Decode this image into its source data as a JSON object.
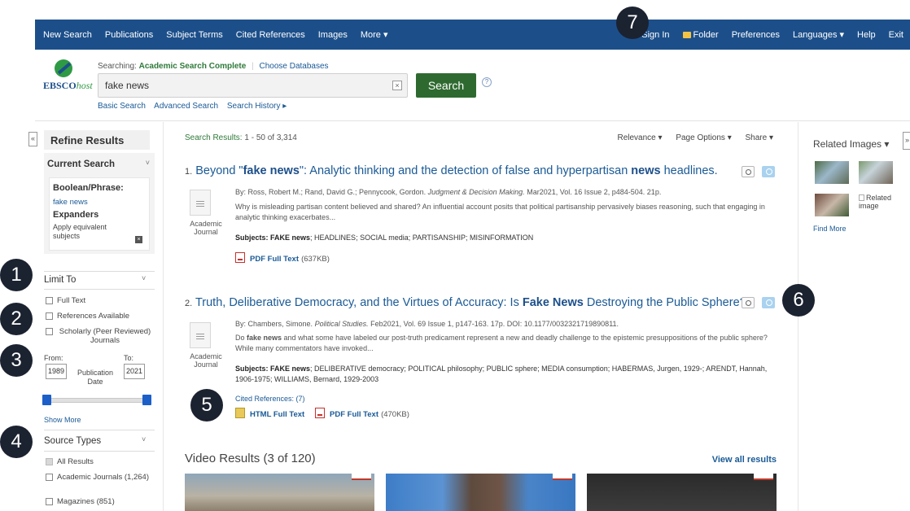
{
  "topnav": {
    "left": [
      "New Search",
      "Publications",
      "Subject Terms",
      "Cited References",
      "Images",
      "More ▾"
    ],
    "right": {
      "sign_in": "Sign In",
      "folder": "Folder",
      "preferences": "Preferences",
      "languages": "Languages ▾",
      "help": "Help",
      "exit": "Exit"
    }
  },
  "header": {
    "logo_main": "EBSCO",
    "logo_sub": "host",
    "searching_label": "Searching:",
    "database": "Academic Search Complete",
    "choose_db": "Choose Databases",
    "query": "fake news",
    "search_button": "Search",
    "links": [
      "Basic Search",
      "Advanced Search",
      "Search History ▸"
    ]
  },
  "sidebar": {
    "refine_title": "Refine Results",
    "current_search": {
      "title": "Current Search",
      "boolean_label": "Boolean/Phrase:",
      "term": "fake news",
      "expanders_label": "Expanders",
      "expander_item": "Apply equivalent subjects"
    },
    "limit_to": {
      "title": "Limit To",
      "options": [
        "Full Text",
        "References Available",
        "Scholarly (Peer Reviewed) Journals"
      ],
      "from_label": "From:",
      "to_label": "To:",
      "from_year": "1989",
      "to_year": "2021",
      "date_label": "Publication Date",
      "show_more": "Show More"
    },
    "source_types": {
      "title": "Source Types",
      "options": [
        "All Results",
        "Academic Journals (1,264)",
        "Magazines (851)"
      ]
    }
  },
  "main": {
    "results_label": "Search Results:",
    "results_range": "1 - 50 of 3,314",
    "options": [
      "Relevance ▾",
      "Page Options ▾",
      "Share ▾"
    ],
    "results": [
      {
        "num": "1.",
        "title_pre": "Beyond \"",
        "title_bold1": "fake news",
        "title_mid": "\": Analytic thinking and the detection of false and hyperpartisan ",
        "title_bold2": "news",
        "title_post": " headlines.",
        "type": "Academic Journal",
        "byline": "By: Ross, Robert M.; Rand, David G.; Pennycook, Gordon.",
        "journal": "Judgment & Decision Making.",
        "details": "Mar2021, Vol. 16 Issue 2, p484-504. 21p.",
        "abstract": "Why is misleading partisan content believed and shared? An influential account posits that political partisanship pervasively biases reasoning, such that engaging in analytic thinking exacerbates...",
        "subjects_label": "Subjects:",
        "subjects_bold": "FAKE news",
        "subjects_rest": "; HEADLINES; SOCIAL media; PARTISANSHIP; MISINFORMATION",
        "pdf_label": "PDF Full Text",
        "pdf_size": "(637KB)"
      },
      {
        "num": "2.",
        "title_pre": "Truth, Deliberative Democracy, and the Virtues of Accuracy: Is ",
        "title_bold1": "Fake News",
        "title_post": " Destroying the Public Sphere?",
        "type": "Academic Journal",
        "byline": "By: Chambers, Simone.",
        "journal": "Political Studies.",
        "details": "Feb2021, Vol. 69 Issue 1, p147-163. 17p. DOI: 10.1177/0032321719890811.",
        "abstract_pre": "Do ",
        "abstract_bold": "fake news",
        "abstract_post": " and what some have labeled our post-truth predicament represent a new and deadly challenge to the epistemic presuppositions of the public sphere? While many commentators have invoked...",
        "subjects_label": "Subjects:",
        "subjects_bold": "FAKE news",
        "subjects_rest": "; DELIBERATIVE democracy; POLITICAL philosophy; PUBLIC sphere; MEDIA consumption; HABERMAS, Jurgen, 1929-; ARENDT, Hannah, 1906-1975; WILLIAMS, Bernard, 1929-2003",
        "cited": "Cited References: (7)",
        "html_label": "HTML Full Text",
        "pdf_label": "PDF Full Text",
        "pdf_size": "(470KB)"
      }
    ],
    "video_title": "Video Results (3 of 120)",
    "view_all": "View all results"
  },
  "rightbar": {
    "title": "Related Images ▾",
    "broken_image": "Related image",
    "find_more": "Find More"
  },
  "badges": [
    "1",
    "2",
    "3",
    "4",
    "5",
    "6",
    "7"
  ],
  "icons": {
    "collapse_left": "«",
    "collapse_right": "»",
    "clear": "×",
    "help": "?",
    "caret": "˅",
    "remove": "×"
  }
}
